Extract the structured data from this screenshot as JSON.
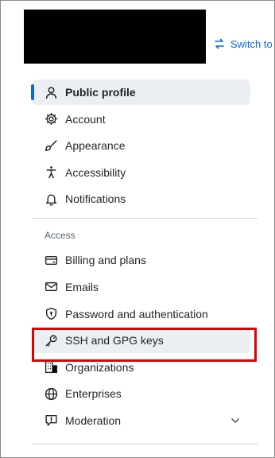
{
  "switch_link": {
    "label": "Switch to"
  },
  "nav": {
    "primary": [
      {
        "label": "Public profile",
        "icon": "person-icon",
        "active": true
      },
      {
        "label": "Account",
        "icon": "gear-icon"
      },
      {
        "label": "Appearance",
        "icon": "paintbrush-icon"
      },
      {
        "label": "Accessibility",
        "icon": "accessibility-icon"
      },
      {
        "label": "Notifications",
        "icon": "bell-icon"
      }
    ],
    "access_label": "Access",
    "access": [
      {
        "label": "Billing and plans",
        "icon": "credit-card-icon"
      },
      {
        "label": "Emails",
        "icon": "mail-icon"
      },
      {
        "label": "Password and authentication",
        "icon": "shield-lock-icon"
      },
      {
        "label": "SSH and GPG keys",
        "icon": "key-icon",
        "highlighted": true
      },
      {
        "label": "Organizations",
        "icon": "organization-icon"
      },
      {
        "label": "Enterprises",
        "icon": "globe-icon"
      },
      {
        "label": "Moderation",
        "icon": "report-icon",
        "expandable": true
      }
    ]
  },
  "colors": {
    "accent": "#0969da",
    "highlight_box": "#e00000",
    "active_bg": "#eceff2"
  }
}
